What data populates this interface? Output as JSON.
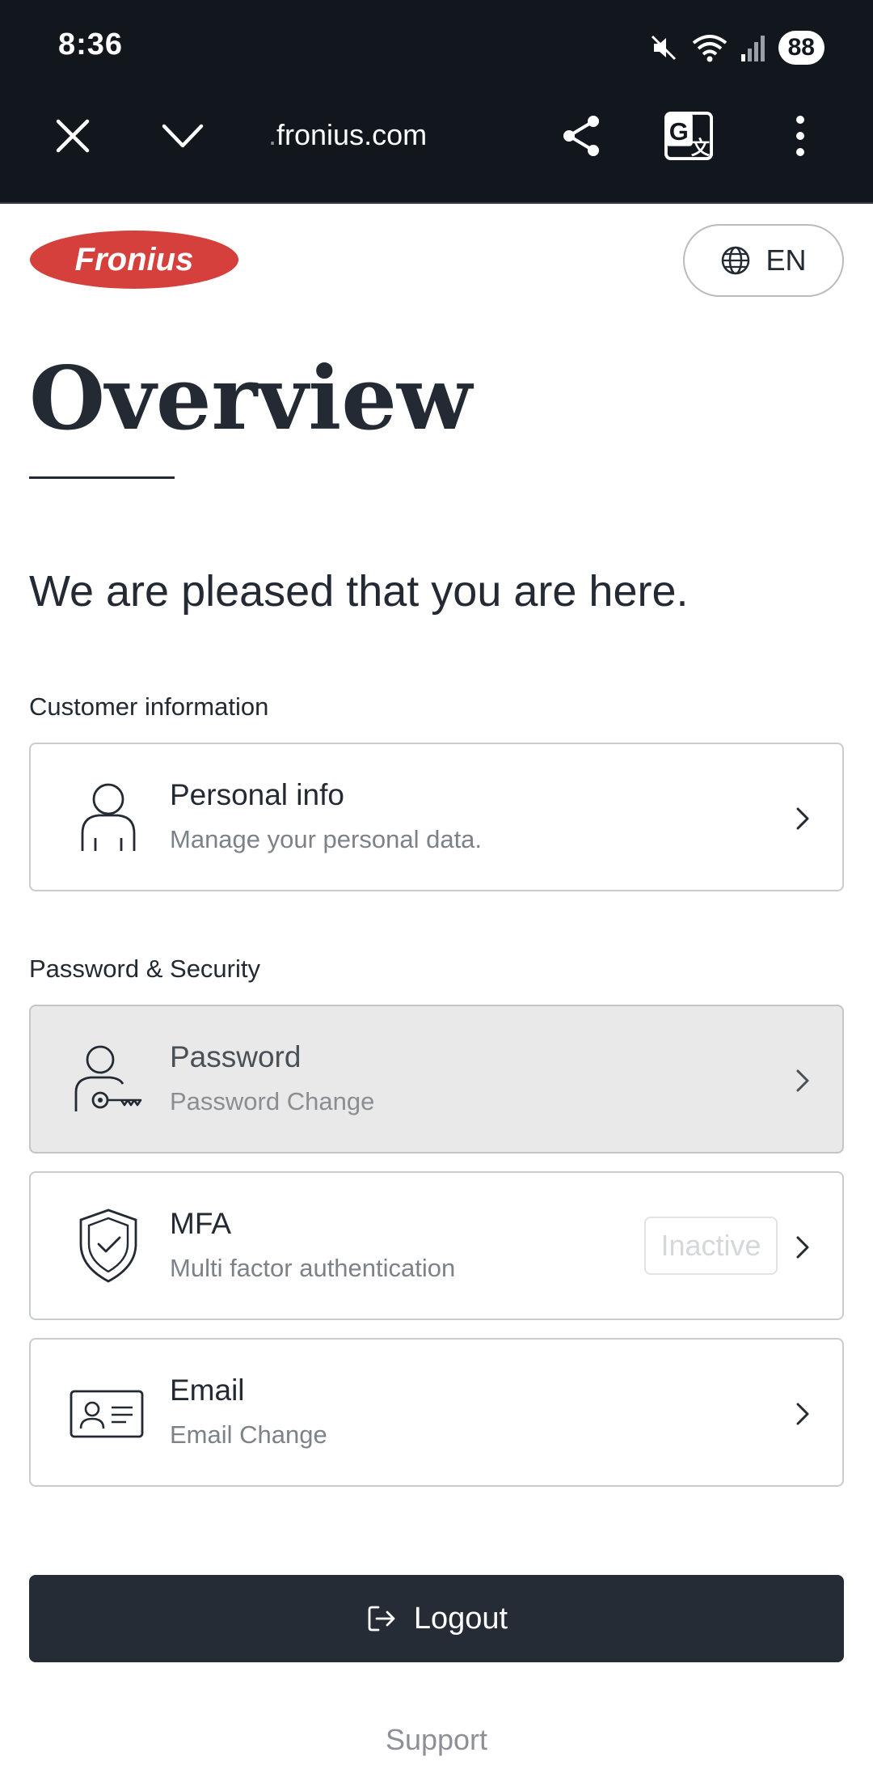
{
  "status_bar": {
    "time": "8:36",
    "battery": "88"
  },
  "browser": {
    "url_prefix": ".",
    "url_domain": "fronius.com"
  },
  "header": {
    "logo_text": "Fronius",
    "language": "EN"
  },
  "page": {
    "title": "Overview",
    "welcome": "We are pleased that you are here."
  },
  "sections": {
    "customer_label": "Customer information",
    "security_label": "Password & Security"
  },
  "cards": {
    "personal": {
      "title": "Personal info",
      "subtitle": "Manage your personal data."
    },
    "password": {
      "title": "Password",
      "subtitle": "Password Change"
    },
    "mfa": {
      "title": "MFA",
      "subtitle": "Multi factor authentication",
      "badge": "Inactive"
    },
    "email": {
      "title": "Email",
      "subtitle": "Email Change"
    }
  },
  "actions": {
    "logout": "Logout",
    "support": "Support"
  },
  "colors": {
    "brand_red": "#d5403c",
    "dark": "#262c36",
    "muted": "#7d8188"
  }
}
